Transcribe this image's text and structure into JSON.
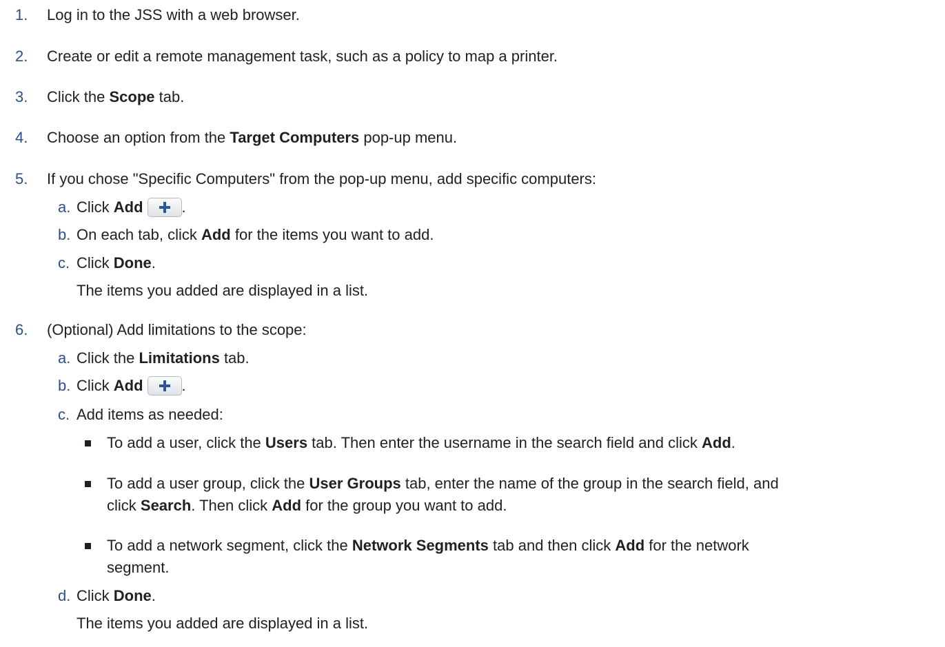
{
  "steps": [
    {
      "num": "1.",
      "text": "Log in to the JSS with a web browser."
    },
    {
      "num": "2.",
      "text": "Create or edit a remote management task, such as a policy to map a printer."
    },
    {
      "num": "3.",
      "pre": "Click the ",
      "bold": "Scope",
      "post": " tab."
    },
    {
      "num": "4.",
      "pre": "Choose an option from the ",
      "bold": "Target Computers",
      "post": " pop-up menu."
    },
    {
      "num": "5.",
      "text": "If you chose \"Specific Computers\" from the pop-up menu, add specific computers:",
      "substeps": [
        {
          "letter": "a.",
          "pre": "Click ",
          "bold": "Add",
          "post": "."
        },
        {
          "letter": "b.",
          "pre": "On each tab, click ",
          "bold": "Add",
          "post": " for the items you want to add."
        },
        {
          "letter": "c.",
          "pre": "Click ",
          "bold": "Done",
          "post": "."
        }
      ],
      "note": "The items you added are displayed in a list."
    },
    {
      "num": "6.",
      "text": "(Optional) Add limitations to the scope:",
      "substeps": [
        {
          "letter": "a.",
          "pre": "Click the ",
          "bold": "Limitations",
          "post": " tab."
        },
        {
          "letter": "b.",
          "pre": "Click ",
          "bold": "Add",
          "post": "."
        },
        {
          "letter": "c.",
          "text": "Add items as needed:"
        },
        {
          "letter": "d.",
          "pre": "Click ",
          "bold": "Done",
          "post": "."
        }
      ],
      "bullets": [
        {
          "t1": "To add a user, click the ",
          "b1": "Users",
          "t2": " tab. Then enter the username in the search field and click ",
          "b2": "Add",
          "t3": "."
        },
        {
          "t1": "To add a user group, click the ",
          "b1": "User Groups",
          "t2": " tab, enter the name of the group in the search field, and",
          "line2_pre": "click ",
          "line2_b1": "Search",
          "line2_mid": ". Then click ",
          "line2_b2": "Add",
          "line2_post": " for the group you want to add."
        },
        {
          "t1": "To add a network segment, click the ",
          "b1": "Network Segments",
          "t2": " tab and then click ",
          "b2": "Add",
          "t3": " for the network",
          "line2": "segment."
        }
      ],
      "note": "The items you added are displayed in a list."
    }
  ],
  "icons": {
    "add_button": "plus-icon",
    "bullet": "square-bullet"
  },
  "colors": {
    "number": "#2c4f8c",
    "text": "#231f20",
    "plus": "#2b579a"
  }
}
